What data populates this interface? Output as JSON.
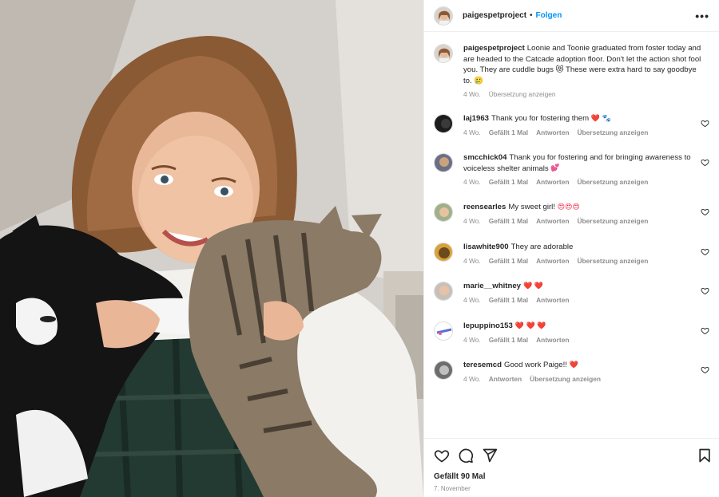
{
  "post": {
    "username": "paigespetproject",
    "separator": "•",
    "follow_label": "Folgen",
    "more_label": "•••",
    "caption": "Loonie and Toonie graduated from foster today and are headed to the Catcade adoption floor. Don't let the action shot fool you. They are cuddle bugs 😻 These were extra hard to say goodbye to. 🥲",
    "caption_time": "4 Wo.",
    "caption_translate": "Übersetzung anzeigen"
  },
  "comments": [
    {
      "user": "laj1963",
      "text": "Thank you for fostering them",
      "emoji": "❤️ 🐾",
      "time": "4 Wo.",
      "likes": "Gefällt 1 Mal",
      "reply": "Antworten",
      "translate": "Übersetzung anzeigen"
    },
    {
      "user": "smcchick04",
      "text": "Thank you for fostering and for bringing awareness to voiceless shelter animals",
      "emoji": "💕",
      "time": "4 Wo.",
      "likes": "Gefällt 1 Mal",
      "reply": "Antworten",
      "translate": "Übersetzung anzeigen"
    },
    {
      "user": "reensearles",
      "text": "My sweet girl!",
      "emoji": "😍😍😍",
      "time": "4 Wo.",
      "likes": "Gefällt 1 Mal",
      "reply": "Antworten",
      "translate": "Übersetzung anzeigen"
    },
    {
      "user": "lisawhite900",
      "text": "They are adorable",
      "emoji": "",
      "time": "4 Wo.",
      "likes": "Gefällt 1 Mal",
      "reply": "Antworten",
      "translate": "Übersetzung anzeigen"
    },
    {
      "user": "marie__whitney",
      "text": "",
      "emoji": "❤️ ❤️",
      "time": "4 Wo.",
      "likes": "Gefällt 1 Mal",
      "reply": "Antworten",
      "translate": ""
    },
    {
      "user": "lepuppino153",
      "text": "",
      "emoji": "❤️ ❤️ ❤️",
      "time": "4 Wo.",
      "likes": "Gefällt 1 Mal",
      "reply": "Antworten",
      "translate": ""
    },
    {
      "user": "teresemcd",
      "text": "Good work Paige!!",
      "emoji": "❤️",
      "time": "4 Wo.",
      "likes": "",
      "reply": "Antworten",
      "translate": "Übersetzung anzeigen"
    }
  ],
  "footer": {
    "likes": "Gefällt 90 Mal",
    "date": "7. November"
  },
  "icons": {
    "heart": "heart-icon",
    "comment": "comment-icon",
    "share": "share-icon",
    "save": "bookmark-icon",
    "more": "more-icon"
  },
  "colors": {
    "follow": "#0095f6",
    "secondary_text": "#8e8e8e",
    "heart_red": "#ed1c3a"
  }
}
